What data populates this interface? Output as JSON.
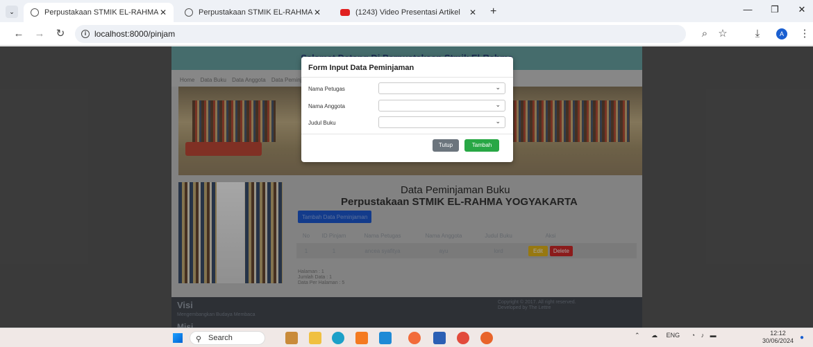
{
  "browser": {
    "tabs": [
      {
        "title": "Perpustakaan STMIK EL-RAHMA",
        "active": true,
        "icon": "globe-icon"
      },
      {
        "title": "Perpustakaan STMIK EL-RAHMA",
        "active": false,
        "icon": "globe-icon"
      },
      {
        "title": "(1243) Video Presentasi Artikel",
        "active": false,
        "icon": "youtube-icon"
      }
    ],
    "new_tab": "+",
    "address": "localhost:8000/pinjam",
    "window_controls": [
      "minimize",
      "restore",
      "close"
    ]
  },
  "page": {
    "banner": "Selamat Datang Di Perpustakaan Stmik El-Rahma",
    "breadcrumb": [
      "Home",
      "Data Buku",
      "Data Anggota",
      "Data Peminjaman"
    ],
    "title_line1": "Data Peminjaman Buku",
    "title_line2": "Perpustakaan STMIK EL-RAHMA YOGYAKARTA",
    "add_button": "Tambah Data Peminjaman",
    "table": {
      "headers": [
        "No",
        "ID Pinjam",
        "Nama Petugas",
        "Nama Anggota",
        "Judul Buku",
        "Aksi"
      ],
      "rows": [
        {
          "no": "1",
          "id": "1",
          "petugas": "ancea syafitya",
          "anggota": "ayu",
          "judul": "lord",
          "edit": "Edit",
          "delete": "Delete"
        }
      ]
    },
    "info": {
      "halaman": "Halaman : 1",
      "jumlah": "Jumlah Data : 1",
      "per_halaman": "Data Per Halaman : 5"
    },
    "footer": {
      "visi": "Visi",
      "visi_text": "Mengembangkan Budaya Membaca",
      "misi": "Misi",
      "copyright": "Copyright © 2017. All right reserved.",
      "designer": "Developed by The Lettre"
    }
  },
  "modal": {
    "title": "Form Input Data Peminjaman",
    "fields": [
      {
        "label": "Nama Petugas",
        "value": ""
      },
      {
        "label": "Nama Anggota",
        "value": ""
      },
      {
        "label": "Judul Buku",
        "value": ""
      }
    ],
    "close_label": "Tutup",
    "submit_label": "Tambah"
  },
  "taskbar": {
    "search_placeholder": "Search",
    "tray_lang": "ENG",
    "time": "12:12",
    "date": "30/06/2024"
  },
  "colors": {
    "banner": "#6aa6a7",
    "primary": "#1e5bd6",
    "success": "#28a745",
    "secondary": "#6c757d",
    "warning": "#e8b81a",
    "danger": "#d62a2a"
  }
}
